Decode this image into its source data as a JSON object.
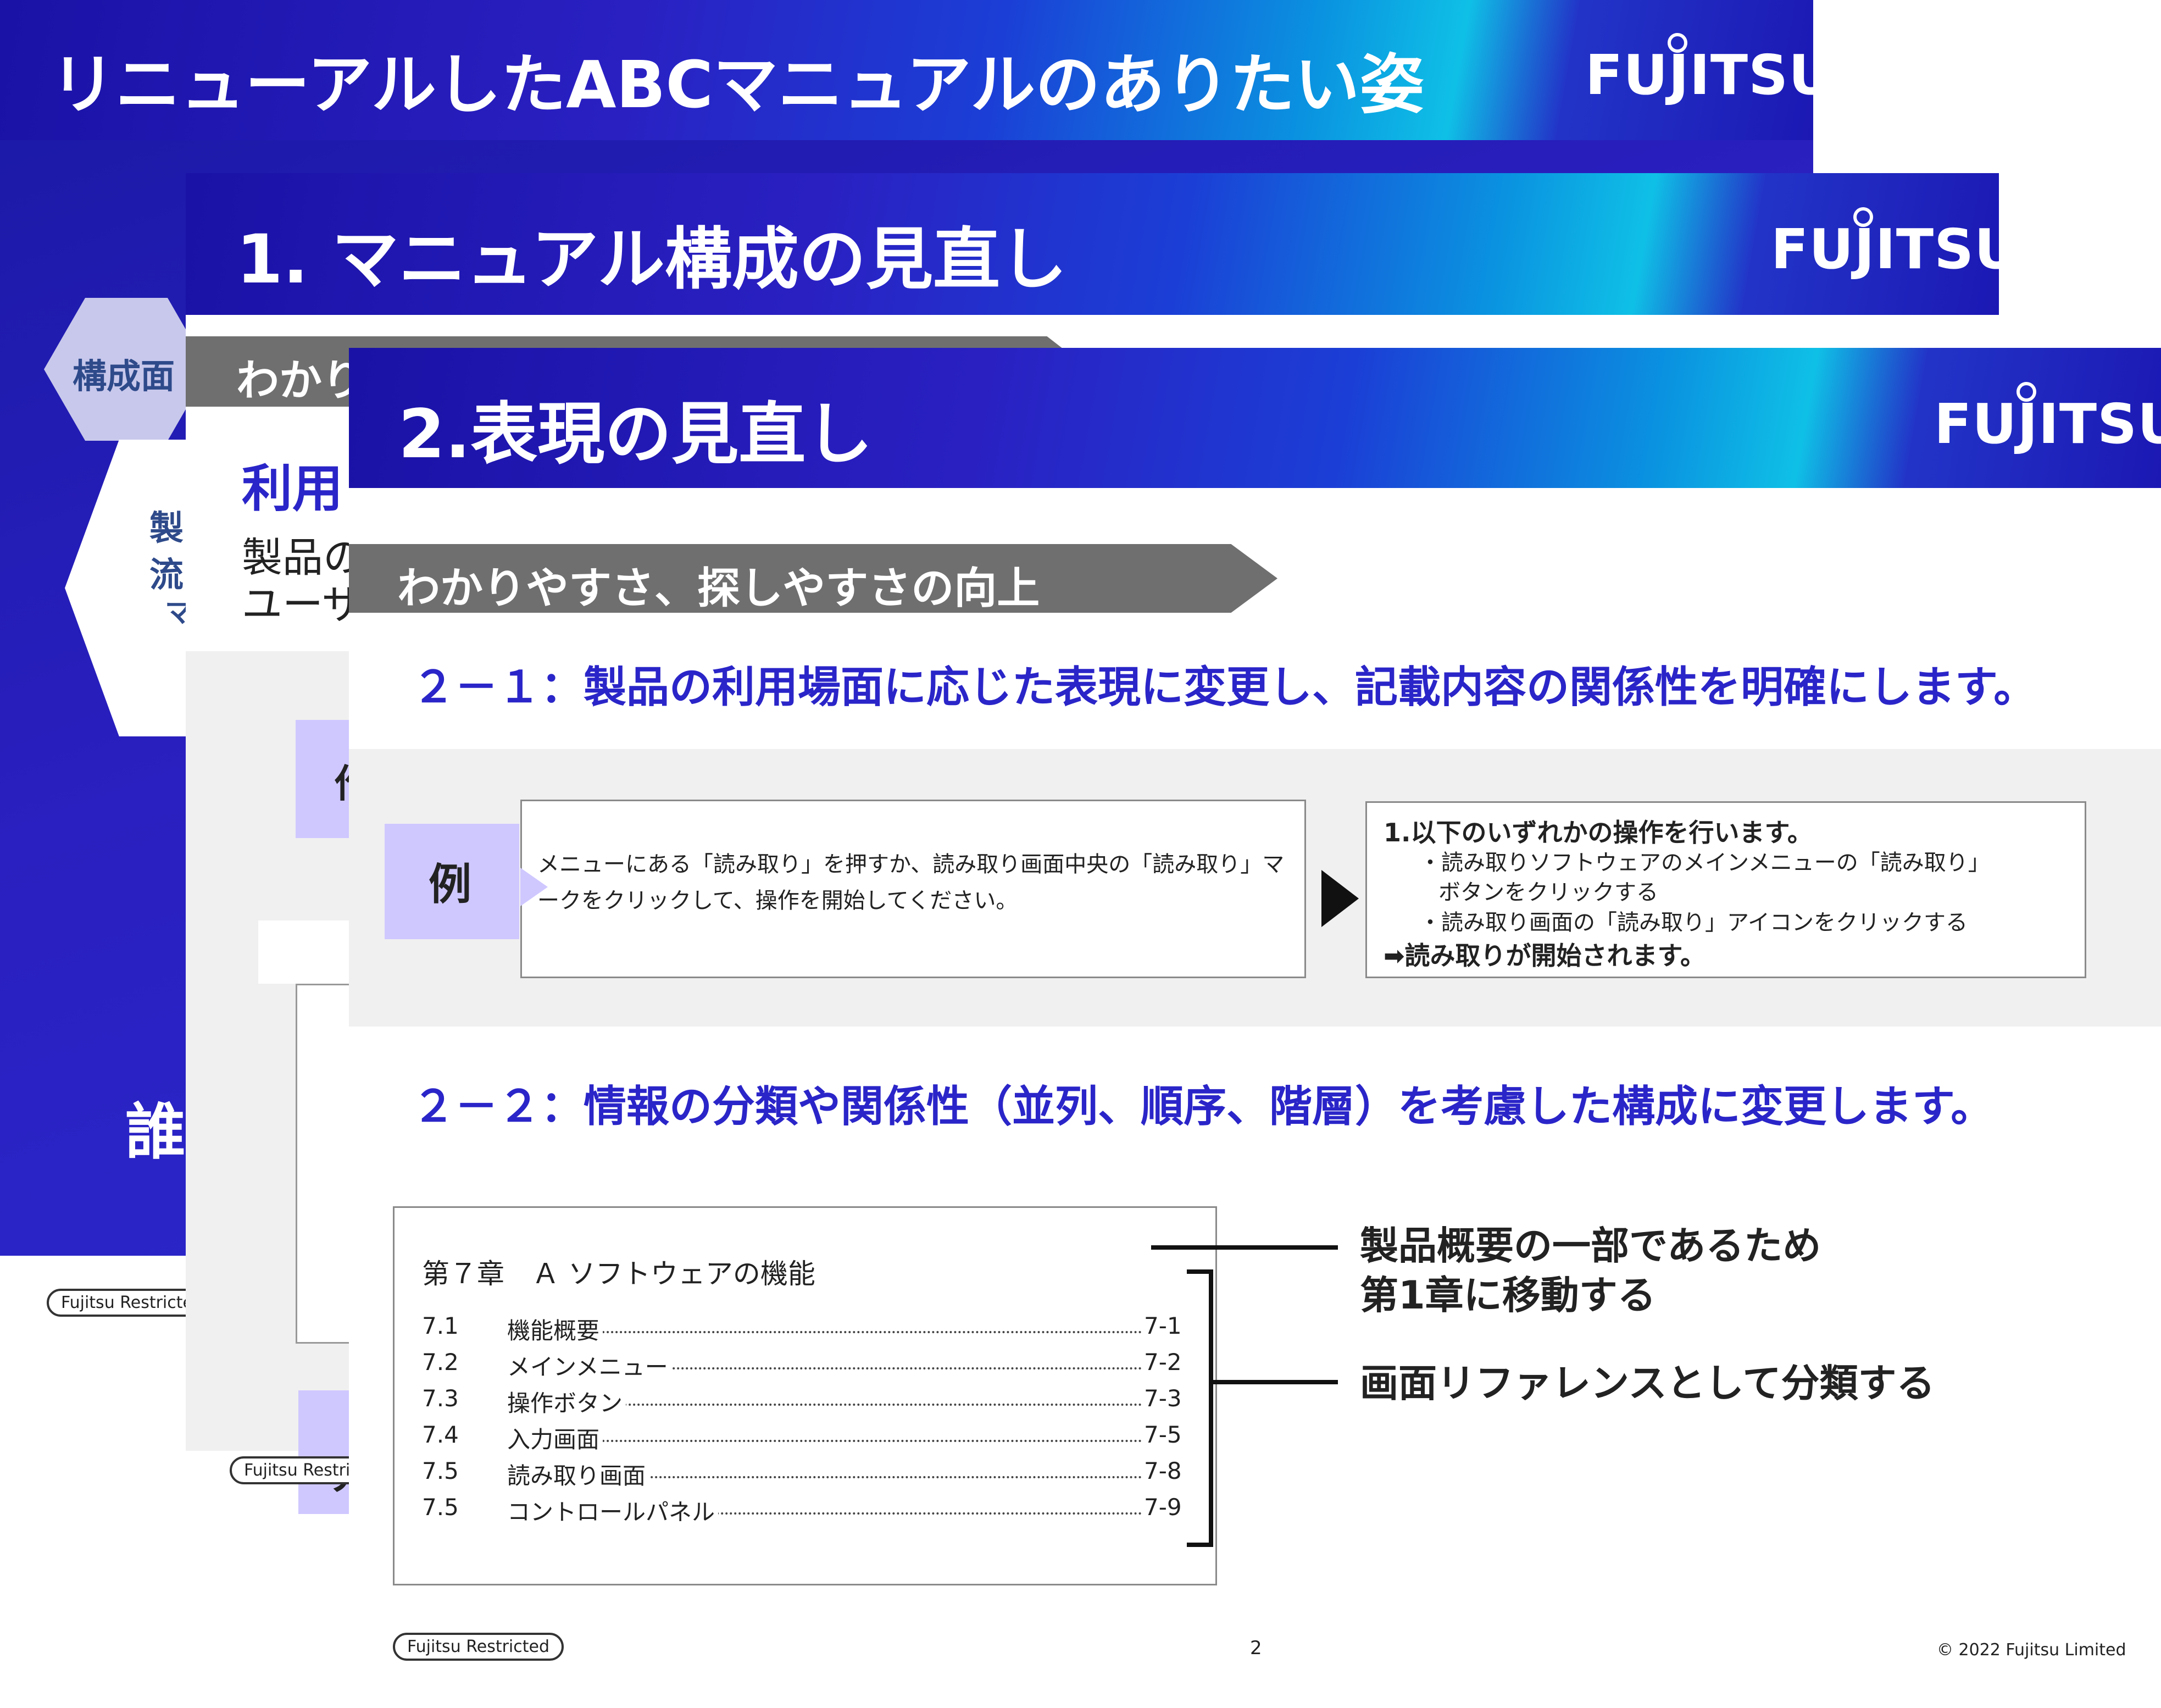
{
  "slide1": {
    "title": "リニューアルしたABCマニュアルのありたい姿",
    "logo": "FUJITSU",
    "hex_label": "構成面",
    "side_chars": [
      "製",
      "流",
      "マ"
    ],
    "big_char": "誰",
    "restricted": "Fujitsu Restricted"
  },
  "slide2": {
    "title": "1. マニュアル構成の見直し",
    "logo": "FUJITSU",
    "banner": "わかり",
    "heading": "利用",
    "line1": "製品の",
    "line2": "ユーザ",
    "box_char_1": "作",
    "box_char_2": "サ",
    "restricted": "Fujitsu Restricted"
  },
  "slide3": {
    "title": "2.表現の見直し",
    "logo": "FUJITSU",
    "banner": "わかりやすさ、探しやすさの向上",
    "sub1": "２－１：製品の利用場面に応じた表現に変更し、記載内容の関係性を明確にします。",
    "example_label": "例",
    "before_text": "メニューにある「読み取り」を押すか、読み取り画面中央の「読み取り」マークをクリックして、操作を開始してください。",
    "after": {
      "line1": "1.以下のいずれかの操作を行います。",
      "bullet1a": "・読み取りソフトウェアのメインメニューの「読み取り」",
      "bullet1b": "ボタンをクリックする",
      "bullet2": "・読み取り画面の「読み取り」アイコンをクリックする",
      "result": "➡読み取りが開始されます。"
    },
    "sub2": "２－２：情報の分類や関係性（並列、順序、階層）を考慮した構成に変更します。",
    "toc": {
      "chapter": "第７章　Ａ ソフトウェアの機能",
      "rows": [
        {
          "num": "7.1",
          "label": "機能概要",
          "page": "7-1"
        },
        {
          "num": "7.2",
          "label": "メインメニュー",
          "page": "7-2"
        },
        {
          "num": "7.3",
          "label": "操作ボタン",
          "page": "7-3"
        },
        {
          "num": "7.4",
          "label": "入力画面",
          "page": "7-5"
        },
        {
          "num": "7.5",
          "label": "読み取り画面",
          "page": "7-8"
        },
        {
          "num": "7.5",
          "label": "コントロールパネル",
          "page": "7-9"
        }
      ]
    },
    "note1a": "製品概要の一部であるため",
    "note1b": "第1章に移動する",
    "note2": "画面リファレンスとして分類する",
    "restricted": "Fujitsu Restricted",
    "page_number": "2",
    "copyright": "© 2022 Fujitsu Limited"
  }
}
